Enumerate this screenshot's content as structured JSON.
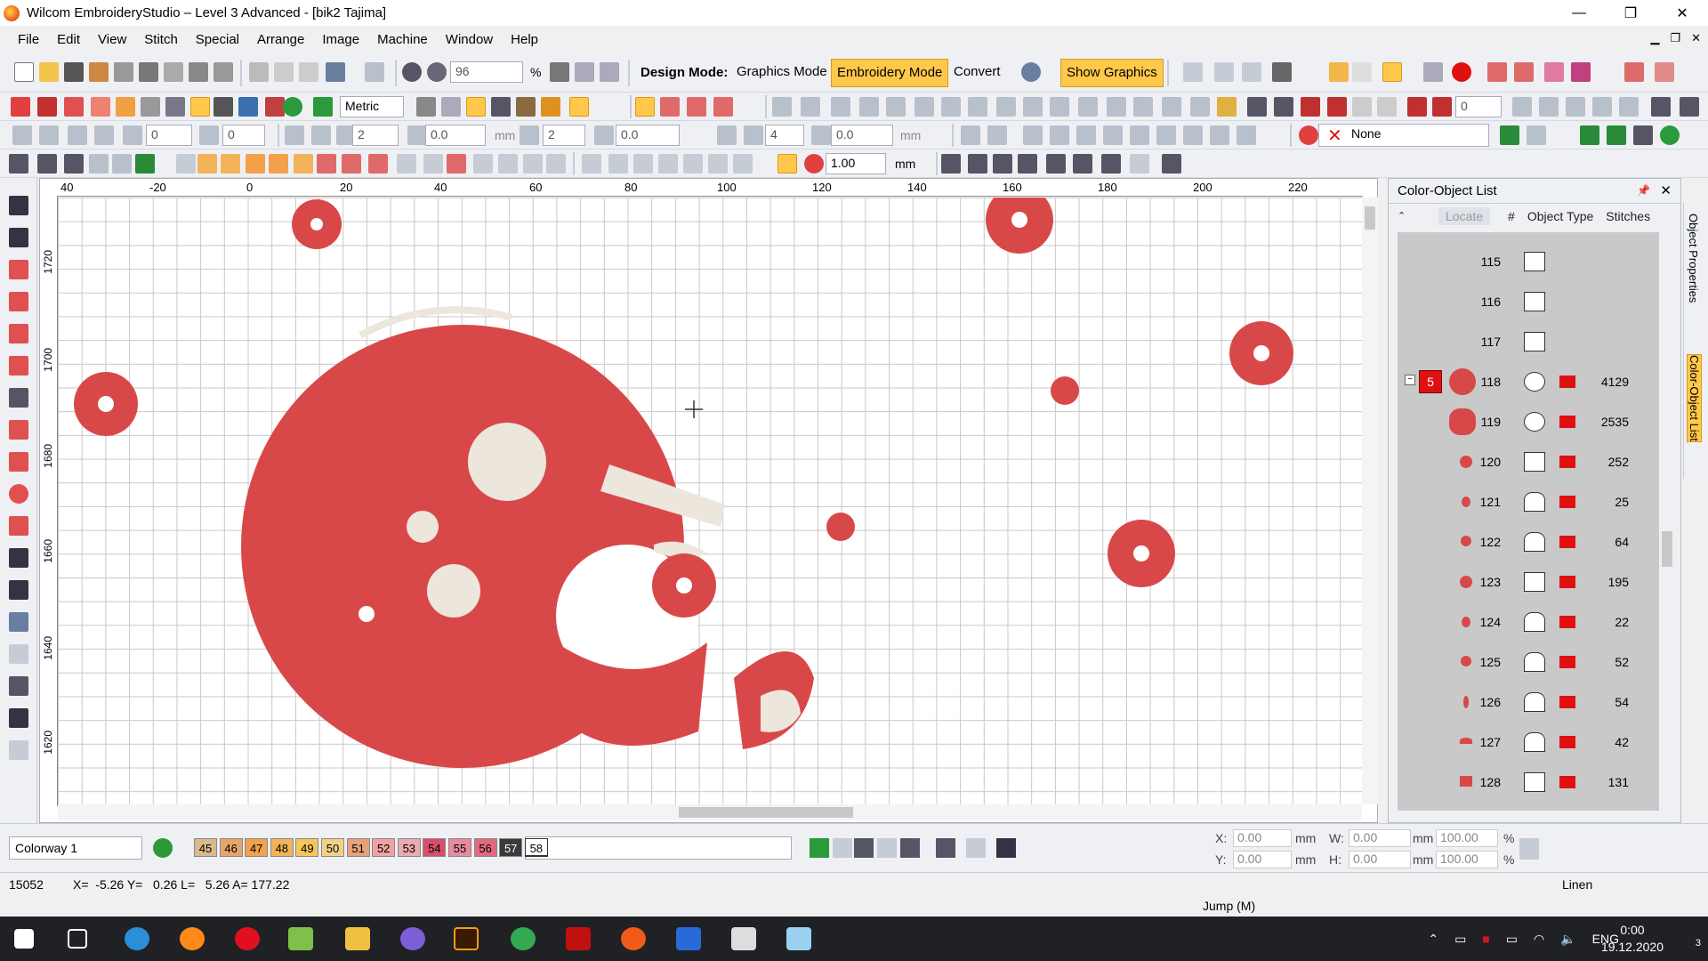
{
  "window": {
    "title": "Wilcom EmbroideryStudio – Level 3 Advanced - [bik2        Tajima]",
    "minimize": "—",
    "maximize": "❐",
    "close": "✕"
  },
  "menu": [
    "File",
    "Edit",
    "View",
    "Stitch",
    "Special",
    "Arrange",
    "Image",
    "Machine",
    "Window",
    "Help"
  ],
  "toolbar": {
    "zoom_value": "96",
    "zoom_unit": "%",
    "design_mode_label": "Design Mode:",
    "graphics_mode": "Graphics Mode",
    "embroidery_mode": "Embroidery Mode",
    "convert": "Convert",
    "show_graphics": "Show Graphics",
    "units": "Metric",
    "none_select": "None",
    "field_zero_a": "0",
    "field_zero_b": "0",
    "field_two": "2",
    "field_00": "0.0",
    "unit_mm": "mm",
    "field_two_b": "2",
    "field_00_b": "0.0",
    "field_four": "4",
    "field_00_c": "0.0",
    "field_zero_c": "0",
    "scale_value": "1.00",
    "scale_unit": "mm"
  },
  "rulers": {
    "h_ticks": [
      "40",
      "-20",
      "0",
      "20",
      "40",
      "60",
      "80",
      "100",
      "120",
      "140",
      "160",
      "180",
      "200",
      "220"
    ],
    "v_ticks": [
      "1720",
      "1700",
      "1680",
      "1660",
      "1640",
      "1620"
    ]
  },
  "panel": {
    "title": "Color-Object List",
    "col_locate": "Locate",
    "col_hash": "#",
    "col_type": "Object Type",
    "col_stitches": "Stitches",
    "group_color_number": "5",
    "rows": [
      {
        "num": "115",
        "stitches": ""
      },
      {
        "num": "116",
        "stitches": ""
      },
      {
        "num": "117",
        "stitches": ""
      },
      {
        "num": "118",
        "stitches": "4129"
      },
      {
        "num": "119",
        "stitches": "2535"
      },
      {
        "num": "120",
        "stitches": "252"
      },
      {
        "num": "121",
        "stitches": "25"
      },
      {
        "num": "122",
        "stitches": "64"
      },
      {
        "num": "123",
        "stitches": "195"
      },
      {
        "num": "124",
        "stitches": "22"
      },
      {
        "num": "125",
        "stitches": "52"
      },
      {
        "num": "126",
        "stitches": "54"
      },
      {
        "num": "127",
        "stitches": "42"
      },
      {
        "num": "128",
        "stitches": "131"
      }
    ],
    "side_tab_properties": "Object Properties",
    "side_tab_list": "Color-Object List"
  },
  "palette": {
    "colorway": "Colorway 1",
    "swatches": [
      {
        "label": "45",
        "color": "#d9b98a"
      },
      {
        "label": "46",
        "color": "#e8a56a"
      },
      {
        "label": "47",
        "color": "#f0a24c"
      },
      {
        "label": "48",
        "color": "#f2b25a"
      },
      {
        "label": "49",
        "color": "#f6c65a"
      },
      {
        "label": "50",
        "color": "#f3d08a"
      },
      {
        "label": "51",
        "color": "#e6a07a"
      },
      {
        "label": "52",
        "color": "#f2a2a2"
      },
      {
        "label": "53",
        "color": "#e9aab0"
      },
      {
        "label": "54",
        "color": "#d84f6a"
      },
      {
        "label": "55",
        "color": "#e889a0"
      },
      {
        "label": "56",
        "color": "#e26a7e"
      },
      {
        "label": "57",
        "color": "#3a3a3a"
      },
      {
        "label": "58",
        "color": "#ffffff"
      }
    ]
  },
  "coords": {
    "x_label": "X:",
    "x_value": "0.00",
    "x_unit": "mm",
    "y_label": "Y:",
    "y_value": "0.00",
    "y_unit": "mm",
    "w_label": "W:",
    "w_value": "0.00",
    "w_unit": "mm",
    "w_pct": "100.00",
    "pct": "%",
    "h_label": "H:",
    "h_value": "0.00",
    "h_unit": "mm",
    "h_pct": "100.00"
  },
  "status": {
    "stitch_count": "15052",
    "position": "X=  -5.26 Y=   0.26 L=   5.26 A= 177.22",
    "fabric": "Linen",
    "jump": "Jump (M)"
  },
  "taskbar": {
    "lang": "ENG",
    "time": "0:00",
    "date": "19.12.2020",
    "notifications": "3"
  },
  "colors": {
    "embroidery_red": "#d94848",
    "embroidery_light": "#ece6dc",
    "active_button": "#ffc84a"
  }
}
